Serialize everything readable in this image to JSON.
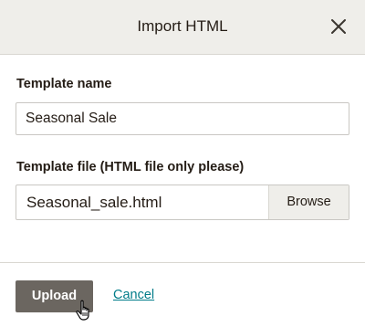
{
  "dialog": {
    "title": "Import HTML",
    "close_icon": "close-icon"
  },
  "form": {
    "template_name": {
      "label": "Template name",
      "value": "Seasonal Sale"
    },
    "template_file": {
      "label": "Template file (HTML file only please)",
      "file_name": "Seasonal_sale.html",
      "browse_label": "Browse"
    }
  },
  "footer": {
    "upload_label": "Upload",
    "cancel_label": "Cancel"
  },
  "cursor": {
    "icon": "hand-pointer-icon"
  },
  "colors": {
    "header_bg": "#efeeea",
    "upload_bg": "#6b6660",
    "link": "#007c89",
    "text": "#241c15"
  }
}
